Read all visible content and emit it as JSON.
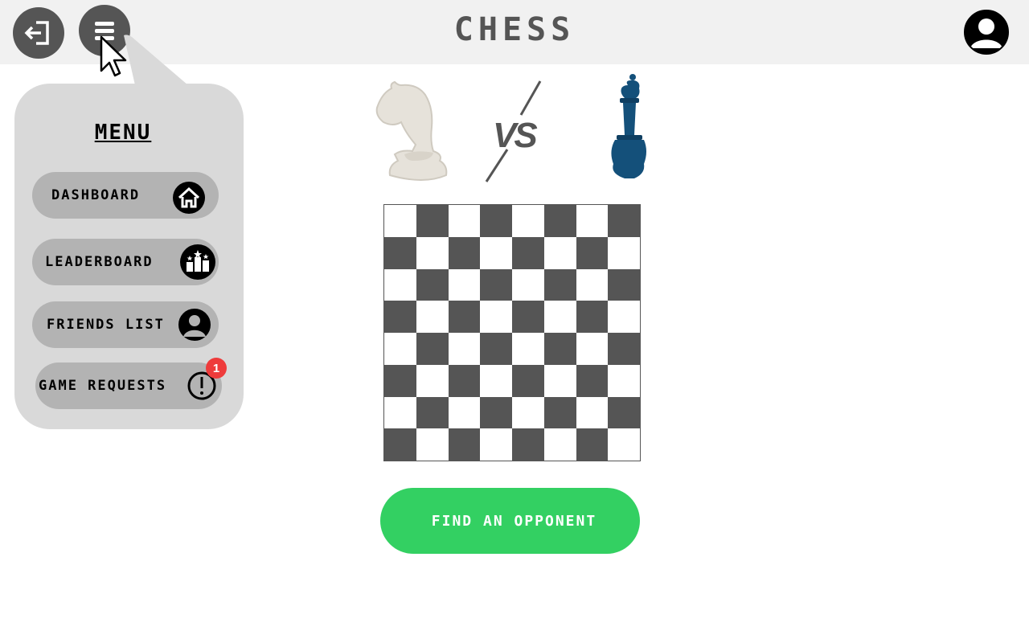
{
  "header": {
    "title": "CHESS",
    "logout_icon": "logout-icon",
    "menu_icon": "hamburger-menu-icon",
    "profile_icon": "user-avatar-icon"
  },
  "menu": {
    "title": "MENU",
    "items": [
      {
        "label": "DASHBOARD",
        "icon": "home-icon"
      },
      {
        "label": "LEADERBOARD",
        "icon": "podium-icon"
      },
      {
        "label": "FRIENDS LIST",
        "icon": "person-icon"
      },
      {
        "label": "GAME REQUESTS",
        "icon": "alert-icon",
        "badge": "1"
      }
    ]
  },
  "versus": {
    "text": "VS",
    "left_piece": "white-knight-icon",
    "right_piece": "blue-bishop-icon"
  },
  "board": {
    "rows": 8,
    "cols": 8,
    "light_color": "#ffffff",
    "dark_color": "#555555"
  },
  "find_button": {
    "label": "FIND AN OPPONENT"
  },
  "colors": {
    "header_bg": "#f1f1f1",
    "dark_gray": "#555555",
    "menu_bg": "#d9d9d9",
    "menu_item_bg": "#b3b3b3",
    "accent_green": "#33d062",
    "badge_red": "#ee3b3b",
    "bishop_blue": "#14507a"
  }
}
